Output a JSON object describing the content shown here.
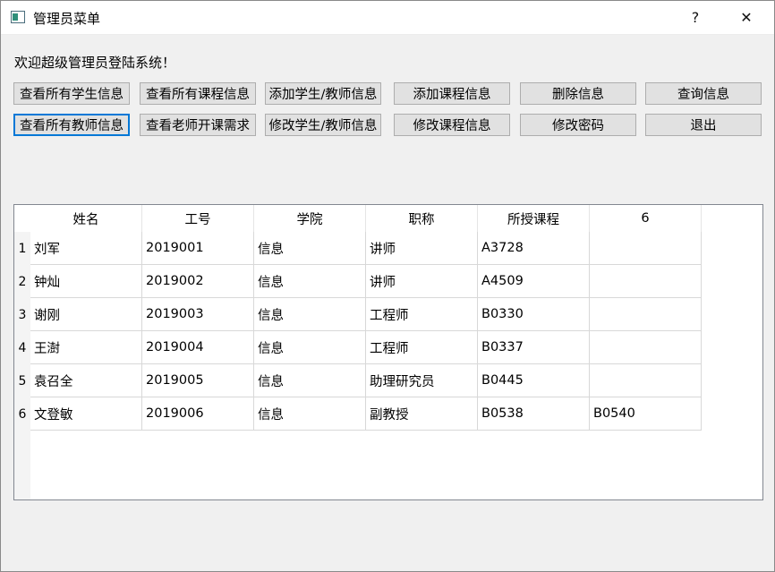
{
  "window": {
    "title": "管理员菜单",
    "help_glyph": "?",
    "close_glyph": "✕"
  },
  "welcome": "欢迎超级管理员登陆系统！",
  "buttons": [
    "查看所有学生信息",
    "查看所有课程信息",
    "添加学生/教师信息",
    "添加课程信息",
    "删除信息",
    "查询信息",
    "查看所有教师信息",
    "查看老师开课需求",
    "修改学生/教师信息",
    "修改课程信息",
    "修改密码",
    "退出"
  ],
  "focused_button_index": 6,
  "table": {
    "columns": [
      "姓名",
      "工号",
      "学院",
      "职称",
      "所授课程",
      "6"
    ],
    "row_numbers": [
      "1",
      "2",
      "3",
      "4",
      "5",
      "6"
    ],
    "rows": [
      [
        "刘军",
        "2019001",
        "信息",
        "讲师",
        "A3728",
        ""
      ],
      [
        "钟灿",
        "2019002",
        "信息",
        "讲师",
        "A4509",
        ""
      ],
      [
        "谢刚",
        "2019003",
        "信息",
        "工程师",
        "B0330",
        ""
      ],
      [
        "王澍",
        "2019004",
        "信息",
        "工程师",
        "B0337",
        ""
      ],
      [
        "袁召全",
        "2019005",
        "信息",
        "助理研究员",
        "B0445",
        ""
      ],
      [
        "文登敏",
        "2019006",
        "信息",
        "副教授",
        "B0538",
        "B0540"
      ]
    ]
  },
  "colors": {
    "focus_border": "#0078d7",
    "button_bg": "#e1e1e1",
    "window_bg": "#f0f0f0"
  }
}
